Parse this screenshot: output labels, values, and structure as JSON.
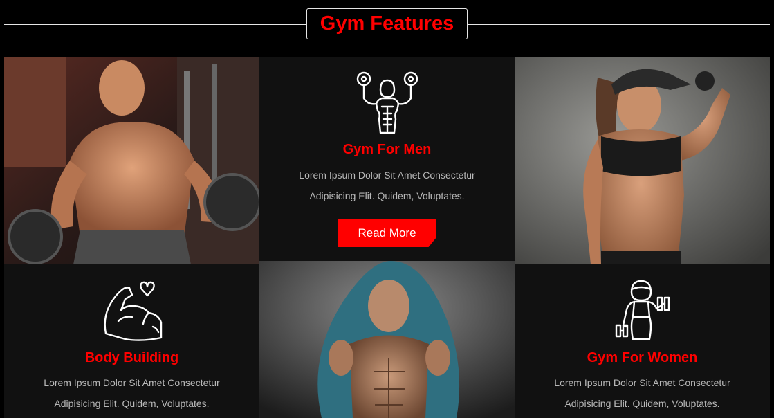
{
  "header": {
    "title": "Gym Features"
  },
  "cards": {
    "men": {
      "icon": "muscle-man-dumbbells-icon",
      "title": "Gym For Men",
      "text_line1": "Lorem Ipsum Dolor Sit Amet Consectetur",
      "text_line2": "Adipisicing Elit. Quidem, Voluptates.",
      "button": "Read More"
    },
    "bodybuilding": {
      "icon": "flexed-arm-heart-icon",
      "title": "Body Building",
      "text_line1": "Lorem Ipsum Dolor Sit Amet Consectetur",
      "text_line2": "Adipisicing Elit. Quidem, Voluptates."
    },
    "women": {
      "icon": "woman-dumbbell-icon",
      "title": "Gym For Women",
      "text_line1": "Lorem Ipsum Dolor Sit Amet Consectetur",
      "text_line2": "Adipisicing Elit. Quidem, Voluptates."
    }
  },
  "colors": {
    "accent": "#ff0000",
    "page_bg": "#000000",
    "card_bg": "#111111",
    "body_text": "#b8b8b8"
  }
}
